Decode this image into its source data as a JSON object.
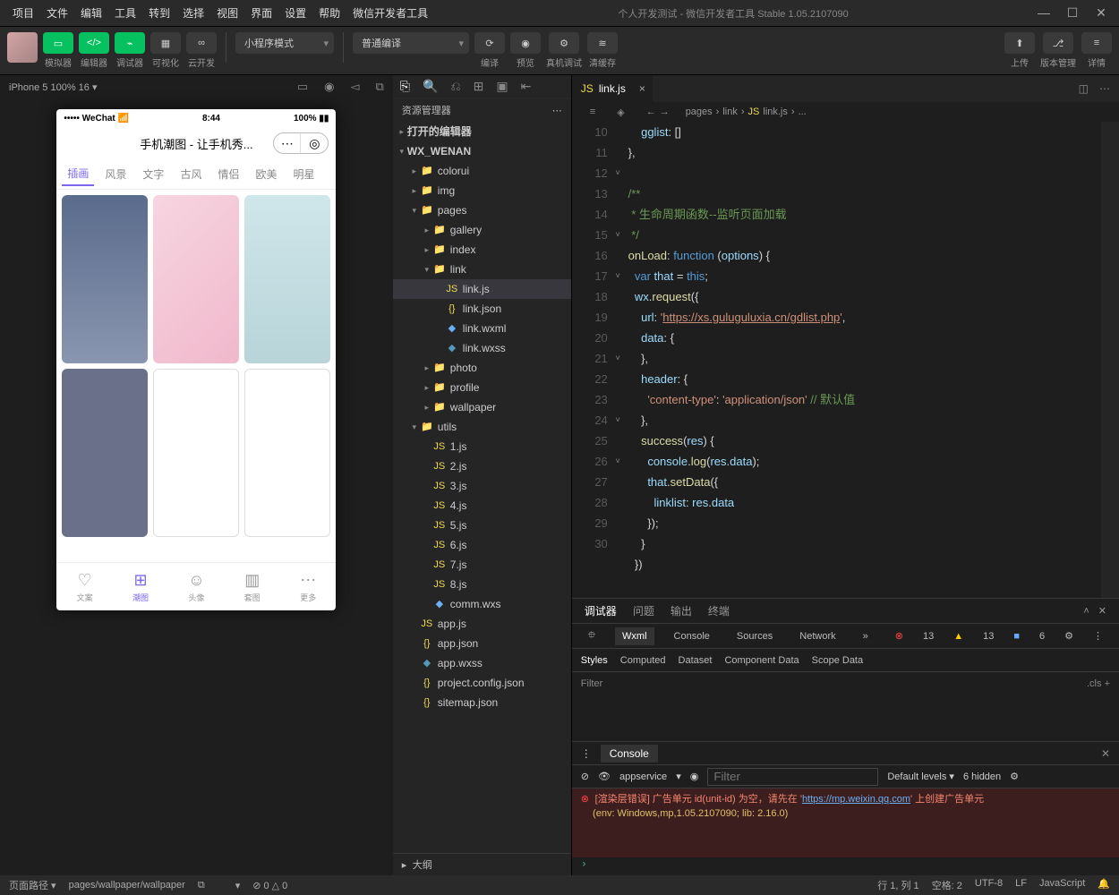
{
  "titlebar": {
    "menus": [
      "项目",
      "文件",
      "编辑",
      "工具",
      "转到",
      "选择",
      "视图",
      "界面",
      "设置",
      "帮助",
      "微信开发者工具"
    ],
    "center": "个人开发测试 - 微信开发者工具 Stable 1.05.2107090"
  },
  "toolbar": {
    "sim": "模拟器",
    "editor": "编辑器",
    "debugger": "调试器",
    "vis": "可视化",
    "cloud": "云开发",
    "mode": "小程序模式",
    "compile": "普通编译",
    "compile_btn": "编译",
    "preview": "预览",
    "realdbg": "真机调试",
    "clearcache": "清缓存",
    "upload": "上传",
    "version": "版本管理",
    "detail": "详情"
  },
  "devicebar": {
    "info": "iPhone 5 100% 16 ▾"
  },
  "phone": {
    "status_left": "••••• WeChat",
    "status_wifi": "📶",
    "status_time": "8:44",
    "status_batt": "100%",
    "title": "手机潮图 - 让手机秀...",
    "tabs": [
      "插画",
      "风景",
      "文字",
      "古风",
      "情侣",
      "欧美",
      "明星"
    ],
    "nav": [
      {
        "ic": "♡",
        "t": "文案"
      },
      {
        "ic": "⊞",
        "t": "潮图"
      },
      {
        "ic": "☺",
        "t": "头像"
      },
      {
        "ic": "▥",
        "t": "套图"
      },
      {
        "ic": "⋯",
        "t": "更多"
      }
    ]
  },
  "explorer": {
    "icons_title": "资源管理器",
    "openeditors": "打开的编辑器",
    "project": "WX_WENAN",
    "tree": [
      {
        "d": 1,
        "t": "f",
        "a": "▸",
        "ic": "📁",
        "cls": "ic-folder",
        "n": "colorui"
      },
      {
        "d": 1,
        "t": "f",
        "a": "▸",
        "ic": "📁",
        "cls": "ic-folder-g",
        "n": "img"
      },
      {
        "d": 1,
        "t": "f",
        "a": "▾",
        "ic": "📁",
        "cls": "ic-folder-g",
        "n": "pages"
      },
      {
        "d": 2,
        "t": "f",
        "a": "▸",
        "ic": "📁",
        "cls": "ic-folder",
        "n": "gallery"
      },
      {
        "d": 2,
        "t": "f",
        "a": "▸",
        "ic": "📁",
        "cls": "ic-folder",
        "n": "index"
      },
      {
        "d": 2,
        "t": "f",
        "a": "▾",
        "ic": "📁",
        "cls": "ic-folder",
        "n": "link"
      },
      {
        "d": 3,
        "t": "i",
        "ic": "JS",
        "cls": "ic-js",
        "n": "link.js",
        "active": true
      },
      {
        "d": 3,
        "t": "i",
        "ic": "{}",
        "cls": "ic-json",
        "n": "link.json"
      },
      {
        "d": 3,
        "t": "i",
        "ic": "◆",
        "cls": "ic-wxml",
        "n": "link.wxml"
      },
      {
        "d": 3,
        "t": "i",
        "ic": "◆",
        "cls": "ic-wxss",
        "n": "link.wxss"
      },
      {
        "d": 2,
        "t": "f",
        "a": "▸",
        "ic": "📁",
        "cls": "ic-folder",
        "n": "photo"
      },
      {
        "d": 2,
        "t": "f",
        "a": "▸",
        "ic": "📁",
        "cls": "ic-folder",
        "n": "profile"
      },
      {
        "d": 2,
        "t": "f",
        "a": "▸",
        "ic": "📁",
        "cls": "ic-folder",
        "n": "wallpaper"
      },
      {
        "d": 1,
        "t": "f",
        "a": "▾",
        "ic": "📁",
        "cls": "ic-folder-g",
        "n": "utils"
      },
      {
        "d": 2,
        "t": "i",
        "ic": "JS",
        "cls": "ic-js",
        "n": "1.js"
      },
      {
        "d": 2,
        "t": "i",
        "ic": "JS",
        "cls": "ic-js",
        "n": "2.js"
      },
      {
        "d": 2,
        "t": "i",
        "ic": "JS",
        "cls": "ic-js",
        "n": "3.js"
      },
      {
        "d": 2,
        "t": "i",
        "ic": "JS",
        "cls": "ic-js",
        "n": "4.js"
      },
      {
        "d": 2,
        "t": "i",
        "ic": "JS",
        "cls": "ic-js",
        "n": "5.js"
      },
      {
        "d": 2,
        "t": "i",
        "ic": "JS",
        "cls": "ic-js",
        "n": "6.js"
      },
      {
        "d": 2,
        "t": "i",
        "ic": "JS",
        "cls": "ic-js",
        "n": "7.js"
      },
      {
        "d": 2,
        "t": "i",
        "ic": "JS",
        "cls": "ic-js",
        "n": "8.js"
      },
      {
        "d": 2,
        "t": "i",
        "ic": "◆",
        "cls": "ic-wxml",
        "n": "comm.wxs"
      },
      {
        "d": 1,
        "t": "i",
        "ic": "JS",
        "cls": "ic-js",
        "n": "app.js"
      },
      {
        "d": 1,
        "t": "i",
        "ic": "{}",
        "cls": "ic-json",
        "n": "app.json"
      },
      {
        "d": 1,
        "t": "i",
        "ic": "◆",
        "cls": "ic-wxss",
        "n": "app.wxss"
      },
      {
        "d": 1,
        "t": "i",
        "ic": "{}",
        "cls": "ic-json",
        "n": "project.config.json"
      },
      {
        "d": 1,
        "t": "i",
        "ic": "{}",
        "cls": "ic-json",
        "n": "sitemap.json"
      }
    ],
    "outline": "大纲"
  },
  "editor": {
    "tab": "link.js",
    "crumb": [
      "pages",
      "link",
      "link.js",
      "..."
    ],
    "lines": [
      {
        "n": "",
        "h": "       <span class='c-prop'>gglist</span>: []"
      },
      {
        "n": "10",
        "h": "   },"
      },
      {
        "n": "11",
        "h": ""
      },
      {
        "n": "12",
        "chev": "˅",
        "h": "   <span class='c-comment'>/**</span>"
      },
      {
        "n": "13",
        "h": "<span class='c-comment'>    * 生命周期函数--监听页面加载</span>"
      },
      {
        "n": "14",
        "h": "<span class='c-comment'>    */</span>"
      },
      {
        "n": "15",
        "chev": "˅",
        "h": "   <span class='c-fn'>onLoad</span>: <span class='c-key'>function</span> (<span class='c-var'>options</span>) {"
      },
      {
        "n": "16",
        "h": "     <span class='c-key'>var</span> <span class='c-var'>that</span> = <span class='c-this'>this</span>;"
      },
      {
        "n": "17",
        "chev": "˅",
        "h": "     <span class='c-var'>wx</span>.<span class='c-fn'>request</span>({"
      },
      {
        "n": "18",
        "h": "       <span class='c-prop'>url</span>: <span class='c-str'>'</span><span class='c-str-u'>https://xs.guluguluxia.cn/gdlist.php</span><span class='c-str'>'</span>,"
      },
      {
        "n": "19",
        "h": "       <span class='c-prop'>data</span>: {"
      },
      {
        "n": "20",
        "h": "       },"
      },
      {
        "n": "21",
        "chev": "˅",
        "h": "       <span class='c-prop'>header</span>: {"
      },
      {
        "n": "22",
        "h": "         <span class='c-str'>'content-type'</span>: <span class='c-str'>'application/json'</span> <span class='c-comment'>// 默认值</span>"
      },
      {
        "n": "23",
        "h": "       },"
      },
      {
        "n": "24",
        "chev": "˅",
        "h": "       <span class='c-fn'>success</span>(<span class='c-var'>res</span>) {"
      },
      {
        "n": "25",
        "h": "         <span class='c-var'>console</span>.<span class='c-fn'>log</span>(<span class='c-var'>res</span>.<span class='c-prop'>data</span>);"
      },
      {
        "n": "26",
        "chev": "˅",
        "h": "         <span class='c-var'>that</span>.<span class='c-fn'>setData</span>({"
      },
      {
        "n": "27",
        "h": "           <span class='c-prop'>linklist</span>: <span class='c-var'>res</span>.<span class='c-prop'>data</span>"
      },
      {
        "n": "28",
        "h": "         });"
      },
      {
        "n": "29",
        "h": "       }"
      },
      {
        "n": "30",
        "h": "     })"
      }
    ]
  },
  "debugger": {
    "tabs": [
      "调试器",
      "问题",
      "输出",
      "终端"
    ],
    "devtools": [
      "Wxml",
      "Console",
      "Sources",
      "Network"
    ],
    "err": "13",
    "warn": "13",
    "info": "6",
    "styletabs": [
      "Styles",
      "Computed",
      "Dataset",
      "Component Data",
      "Scope Data"
    ],
    "filter": "Filter",
    "cls": ".cls"
  },
  "console": {
    "tab": "Console",
    "context": "appservice",
    "levels": "Default levels ▾",
    "hidden": "6 hidden",
    "msg1a": "[渲染层错误] 广告单元 id(unit-id) 为空，请先在 '",
    "msg1link": "https://mp.weixin.qq.com",
    "msg1b": "' 上创建广告单元",
    "msg2": "(env: Windows,mp,1.05.2107090; lib: 2.16.0)",
    "filter_ph": "Filter"
  },
  "footer": {
    "pathlabel": "页面路径 ▾",
    "path": "pages/wallpaper/wallpaper",
    "diag": "⊘ 0 △ 0",
    "pos": "行 1, 列 1",
    "spaces": "空格: 2",
    "enc": "UTF-8",
    "eol": "LF",
    "lang": "JavaScript"
  }
}
